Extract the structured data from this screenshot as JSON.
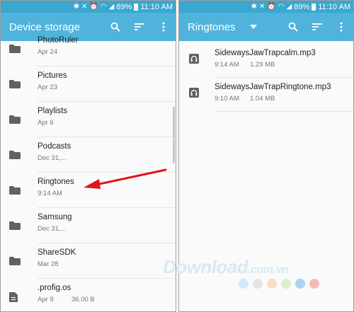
{
  "status": {
    "battery": "89%",
    "time": "11:10 AM"
  },
  "left": {
    "title": "Device storage",
    "items": [
      {
        "name": "PhotoRuler",
        "date": "Apr 24",
        "icon": "folder-icon"
      },
      {
        "name": "Pictures",
        "date": "Apr 23",
        "icon": "folder-icon"
      },
      {
        "name": "Playlists",
        "date": "Apr 6",
        "icon": "folder-icon"
      },
      {
        "name": "Podcasts",
        "date": "Dec 31,...",
        "icon": "folder-icon"
      },
      {
        "name": "Ringtones",
        "date": "9:14 AM",
        "icon": "folder-icon"
      },
      {
        "name": "Samsung",
        "date": "Dec 31,...",
        "icon": "folder-icon"
      },
      {
        "name": "ShareSDK",
        "date": "Mar 28",
        "icon": "folder-icon"
      },
      {
        "name": ".profig.os",
        "date": "Apr 9",
        "size": "36.00 B",
        "icon": "file-icon"
      }
    ]
  },
  "right": {
    "title": "Ringtones",
    "files": [
      {
        "name": "SidewaysJawTrapcalm.mp3",
        "time": "9:14 AM",
        "size": "1.29 MB",
        "icon": "audio-file-icon"
      },
      {
        "name": "SidewaysJawTrapRingtone.mp3",
        "time": "9:10 AM",
        "size": "1.04 MB",
        "icon": "audio-file-icon"
      }
    ]
  },
  "watermark": {
    "main": "Download",
    "sub": ".com.vn"
  },
  "colors": {
    "statusbar": "#3aa7cf",
    "appbar": "#4fb3dc",
    "arrow": "#e0141b",
    "dots": [
      "#cfe9f7",
      "#e3e3e3",
      "#f9ddc5",
      "#d9efc8",
      "#a9d4ef",
      "#f6b9b4"
    ]
  }
}
